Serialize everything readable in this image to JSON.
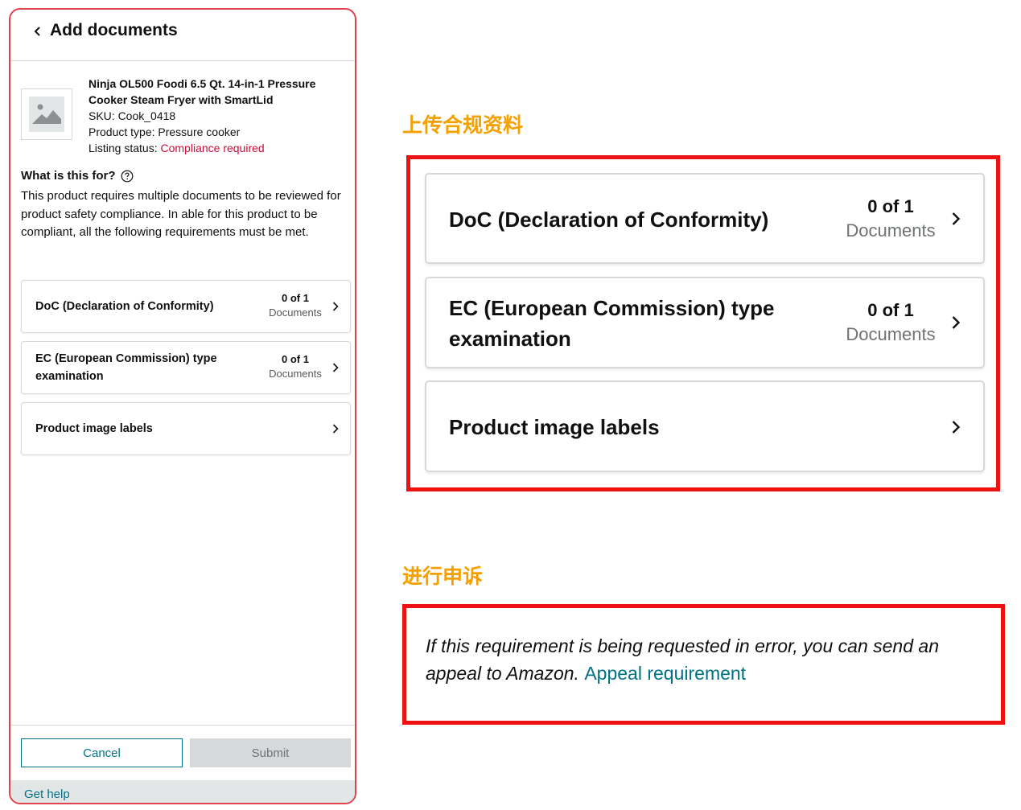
{
  "panel": {
    "title": "Add documents",
    "product": {
      "name": "Ninja OL500 Foodi 6.5 Qt. 14-in-1 Pressure Cooker Steam Fryer with SmartLid",
      "sku": "SKU: Cook_0418",
      "product_type": "Product type: Pressure cooker",
      "listing_status_label": "Listing status: ",
      "listing_status_value": "Compliance required"
    },
    "what_is_this_for": "What is this for?",
    "description": "This product requires multiple documents to be reviewed for product safety compliance. In able for this product to be compliant, all the following requirements must be met.",
    "requirements": [
      {
        "label": "DoC (Declaration of Conformity)",
        "count": "0 of 1",
        "unit": "Documents"
      },
      {
        "label": "EC (European Commission) type examination",
        "count": "0 of 1",
        "unit": "Documents"
      },
      {
        "label": "Product image labels"
      }
    ],
    "cancel_label": "Cancel",
    "submit_label": "Submit",
    "get_help_label": "Get help"
  },
  "annotations": {
    "upload_label": "上传合规资料",
    "appeal_label": "进行申诉"
  },
  "zoom": {
    "requirements": [
      {
        "label": "DoC (Declaration of Conformity)",
        "count": "0 of 1",
        "unit": "Documents"
      },
      {
        "label": "EC (European Commission) type examination",
        "count": "0 of 1",
        "unit": "Documents"
      },
      {
        "label": "Product image labels"
      }
    ],
    "appeal_text": "If this requirement is being requested in error, you can send an appeal to Amazon. ",
    "appeal_link": "Appeal requirement"
  },
  "colors": {
    "panel_border": "#e0434f",
    "annotation_box": "#ee1111",
    "annotation_text": "#f5a000",
    "link": "#007185",
    "status_alert": "#cc0c39"
  },
  "icons": [
    "back-chevron-icon",
    "image-placeholder-icon",
    "help-circle-icon",
    "chevron-right-icon"
  ]
}
